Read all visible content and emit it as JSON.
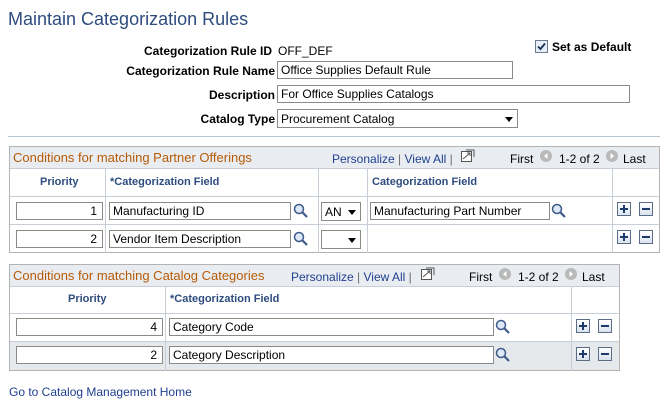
{
  "page": {
    "title": "Maintain Categorization Rules"
  },
  "form": {
    "rule_id_label": "Categorization Rule ID",
    "rule_id_value": "OFF_DEF",
    "set_default_label": "Set as Default",
    "set_default_checked": true,
    "rule_name_label": "Categorization Rule Name",
    "rule_name_value": "Office Supplies Default Rule",
    "description_label": "Description",
    "description_value": "For Office Supplies Catalogs",
    "catalog_type_label": "Catalog Type",
    "catalog_type_value": "Procurement Catalog"
  },
  "grid1": {
    "title": "Conditions for matching Partner Offerings",
    "personalize": "Personalize",
    "view_all": "View All",
    "first": "First",
    "range": "1-2 of 2",
    "last": "Last",
    "col_priority": "Priority",
    "col_field": "*Categorization Field",
    "col_field2": "Categorization Field",
    "rows": [
      {
        "priority": "1",
        "field": "Manufacturing ID",
        "op": "AN",
        "field2": "Manufacturing Part Number"
      },
      {
        "priority": "2",
        "field": "Vendor Item Description",
        "op": "",
        "field2": ""
      }
    ]
  },
  "grid2": {
    "title": "Conditions for matching Catalog Categories",
    "personalize": "Personalize",
    "view_all": "View All",
    "first": "First",
    "range": "1-2 of 2",
    "last": "Last",
    "col_priority": "Priority",
    "col_field": "*Categorization Field",
    "rows": [
      {
        "priority": "4",
        "field": "Category Code"
      },
      {
        "priority": "2",
        "field": "Category Description"
      }
    ]
  },
  "footer": {
    "home_link": "Go to Catalog Management Home"
  },
  "colors": {
    "title": "#2e4c7e",
    "grid_title": "#b85a05",
    "link": "#1f3f8f",
    "header_bg": "#e9edf2"
  }
}
